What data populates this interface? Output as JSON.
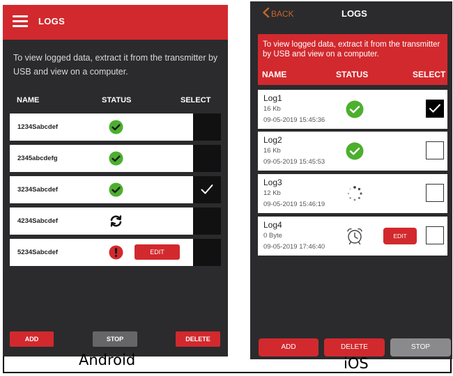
{
  "android": {
    "header_title": "LOGS",
    "info_text": "To view logged data, extract it from the transmitter by USB and view on a computer.",
    "columns": {
      "name": "NAME",
      "status": "STATUS",
      "select": "SELECT"
    },
    "rows": [
      {
        "name": "1234Sabcdef",
        "status": "complete",
        "selected": false
      },
      {
        "name": "2345abcdefg",
        "status": "complete",
        "selected": false
      },
      {
        "name": "3234Sabcdef",
        "status": "complete",
        "selected": true
      },
      {
        "name": "4234Sabcdef",
        "status": "syncing",
        "selected": false
      },
      {
        "name": "5234Sabcdef",
        "status": "error",
        "selected": false,
        "edit_label": "EDIT"
      }
    ],
    "buttons": {
      "add": "ADD",
      "stop": "STOP",
      "delete": "DELETE"
    },
    "caption": "Android"
  },
  "ios": {
    "back_label": "BACK",
    "header_title": "LOGS",
    "info_text": "To view logged data, extract it from the transmitter by USB and view on a computer.",
    "columns": {
      "name": "NAME",
      "status": "STATUS",
      "select": "SELECT"
    },
    "rows": [
      {
        "name": "Log1",
        "size": "16 Kb",
        "date": "09-05-2019 15:45:36",
        "status": "complete",
        "selected": true
      },
      {
        "name": "Log2",
        "size": "16 Kb",
        "date": "09-05-2019 15:45:53",
        "status": "complete",
        "selected": false
      },
      {
        "name": "Log3",
        "size": "12 Kb",
        "date": "09-05-2019 15:46:19",
        "status": "loading",
        "selected": false
      },
      {
        "name": "Log4",
        "size": "0 Byte",
        "date": "09-05-2019 17:46:40",
        "status": "scheduled",
        "selected": false,
        "edit_label": "EDIT"
      }
    ],
    "buttons": {
      "add": "ADD",
      "delete": "DELETE",
      "stop": "STOP"
    },
    "caption": "iOS"
  },
  "colors": {
    "brand_red": "#d2292e",
    "panel_bg": "#2b2b2d",
    "success_green": "#4caf2e",
    "back_orange": "#c9652c"
  },
  "icons": {
    "menu": "hamburger-icon",
    "complete": "check-circle-icon",
    "syncing": "refresh-icon",
    "error": "exclamation-circle-icon",
    "loading": "spinner-icon",
    "scheduled": "alarm-clock-icon",
    "back": "chevron-left-icon"
  }
}
